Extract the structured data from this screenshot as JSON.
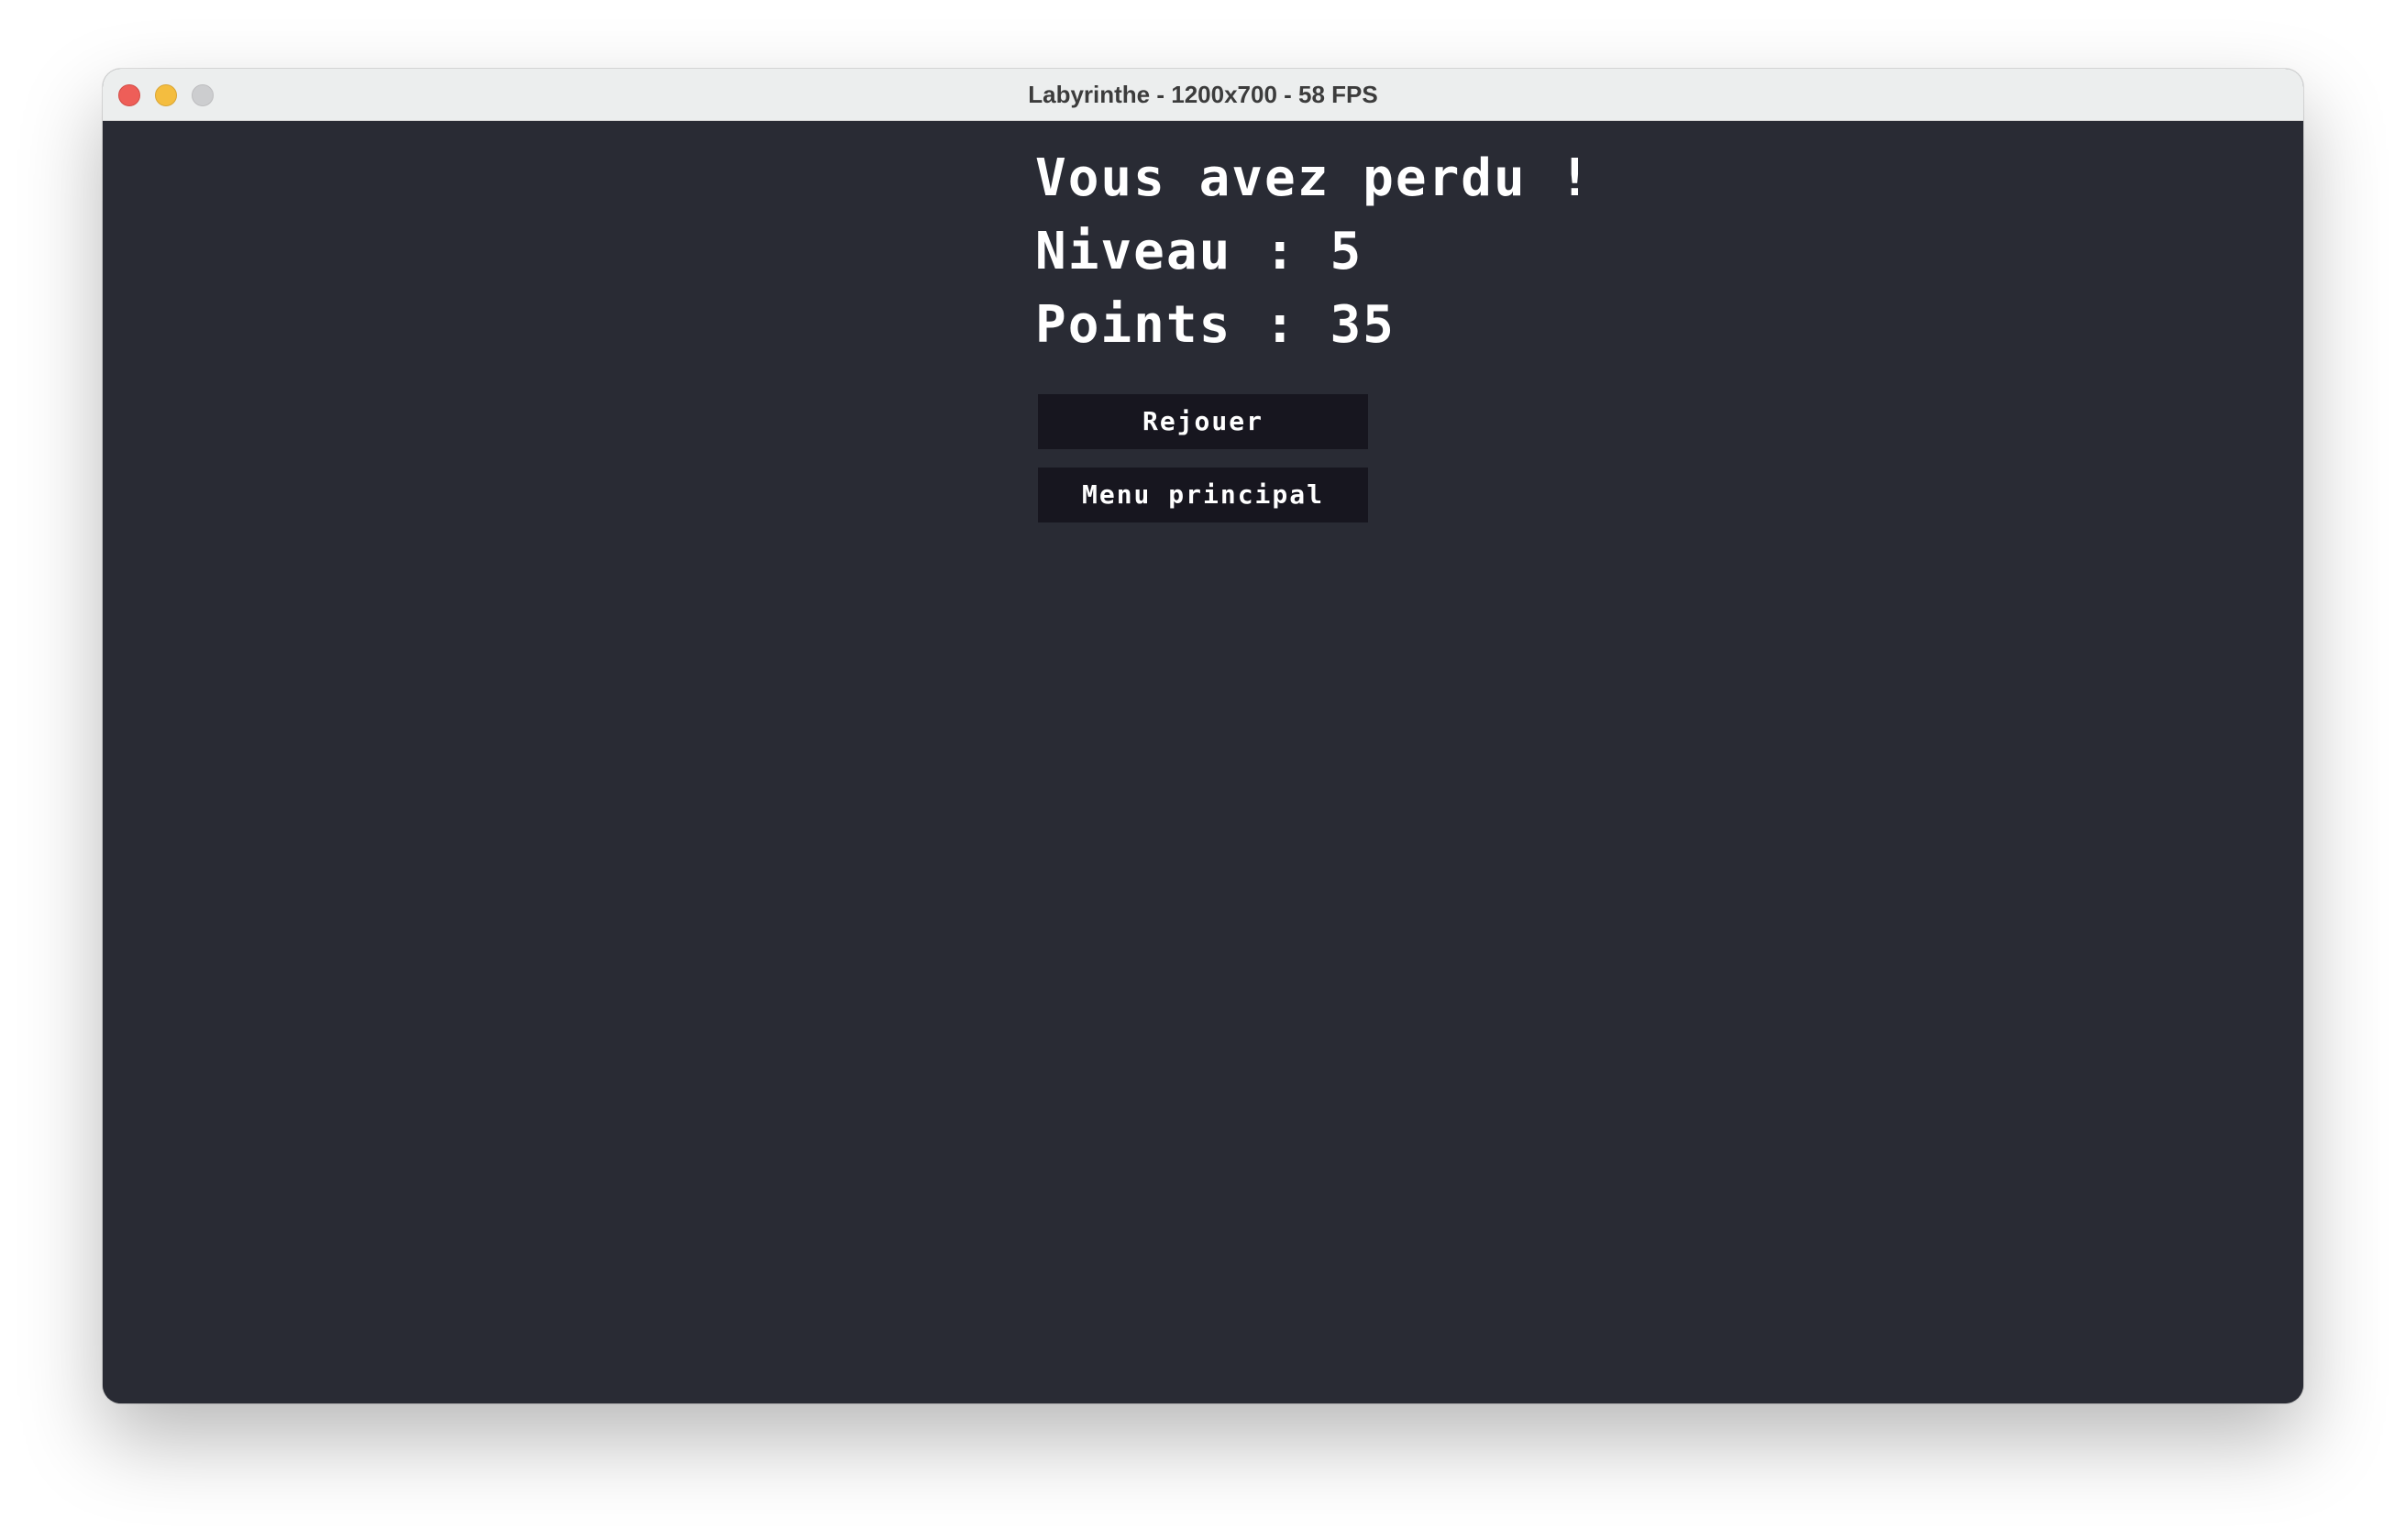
{
  "window": {
    "title": "Labyrinthe - 1200x700 - 58 FPS"
  },
  "game_over": {
    "headline": "Vous avez perdu !",
    "level_label": "Niveau",
    "level_value": "5",
    "points_label": "Points",
    "points_value": "35",
    "separator": " : "
  },
  "buttons": {
    "replay_label": "Rejouer",
    "main_menu_label": "Menu principal"
  },
  "colors": {
    "background": "#292b34",
    "button_background": "#17161f",
    "text": "#ffffff",
    "traffic_close": "#ee5e58",
    "traffic_minimize": "#f4bd3f",
    "traffic_maximize": "#cccdcf"
  }
}
